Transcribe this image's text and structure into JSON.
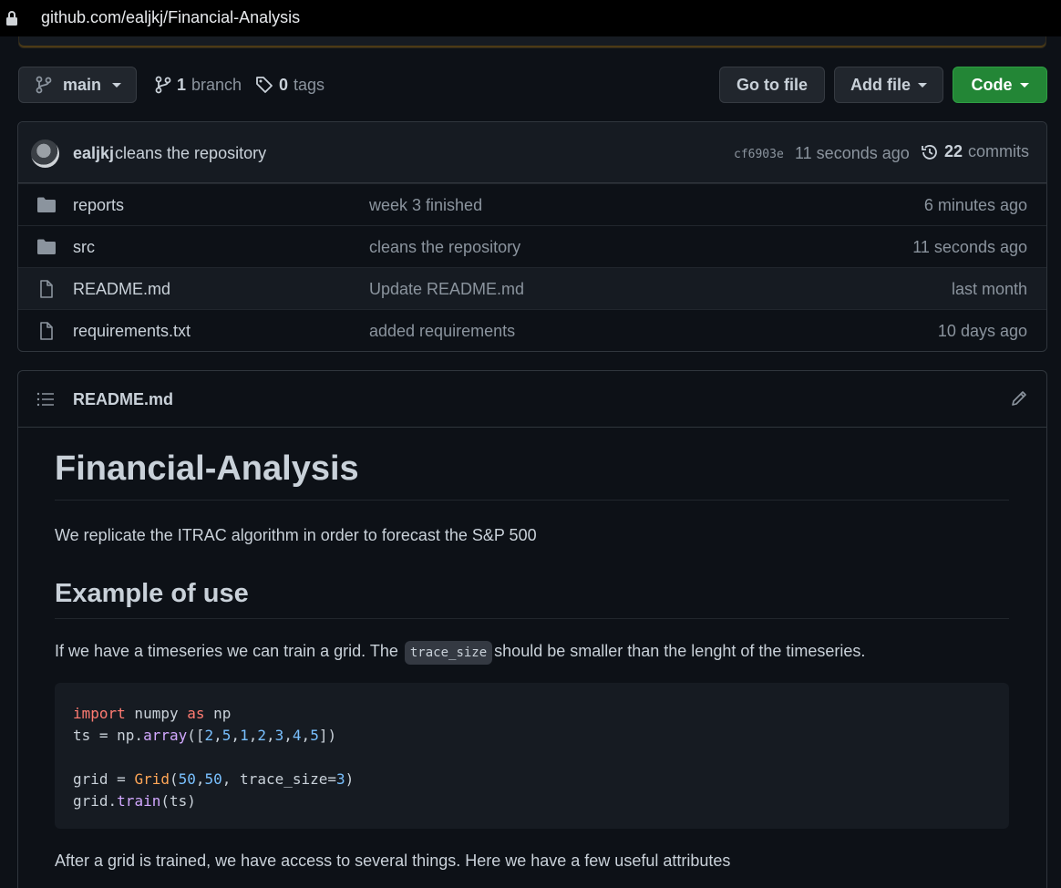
{
  "browser": {
    "url": "github.com/ealjkj/Financial-Analysis"
  },
  "toolbar": {
    "branch": "main",
    "branch_count": "1",
    "branch_word": "branch",
    "tag_count": "0",
    "tag_word": "tags",
    "go_to_file": "Go to file",
    "add_file": "Add file",
    "code": "Code"
  },
  "commit": {
    "author": "ealjkj",
    "message": "cleans the repository",
    "sha": "cf6903e",
    "time": "11 seconds ago",
    "commit_count": "22",
    "commit_word": "commits"
  },
  "files": [
    {
      "type": "folder",
      "name": "reports",
      "message": "week 3 finished",
      "age": "6 minutes ago"
    },
    {
      "type": "folder",
      "name": "src",
      "message": "cleans the repository",
      "age": "11 seconds ago"
    },
    {
      "type": "file",
      "name": "README.md",
      "message": "Update README.md",
      "age": "last month"
    },
    {
      "type": "file",
      "name": "requirements.txt",
      "message": "added requirements",
      "age": "10 days ago"
    }
  ],
  "readme": {
    "filename": "README.md",
    "title": "Financial-Analysis",
    "intro": "We replicate the ITRAC algorithm in order to forecast the S&P 500",
    "section_title": "Example of use",
    "para_before": "If we have a timeseries we can train a grid. The",
    "inline_code": "trace_size",
    "para_after": "should be smaller than the lenght of the timeseries.",
    "code_lines": {
      "l1_kw1": "import",
      "l1_mod": " numpy ",
      "l1_kw2": "as",
      "l1_alias": " np",
      "l2_a": "ts = np.",
      "l2_fn": "array",
      "l2_b": "([",
      "l2_n1": "2",
      "l2_n2": "5",
      "l2_n3": "1",
      "l2_n4": "2",
      "l2_n5": "3",
      "l2_n6": "4",
      "l2_n7": "5",
      "l2_c": "])",
      "l4_a": "grid = ",
      "l4_cls": "Grid",
      "l4_b": "(",
      "l4_n1": "50",
      "l4_n2": "50",
      "l4_c": ", trace_size=",
      "l4_n3": "3",
      "l4_d": ")",
      "l5_a": "grid.",
      "l5_fn": "train",
      "l5_b": "(ts)"
    },
    "after_code": "After a grid is trained, we have access to several things. Here we have a few useful attributes"
  },
  "colors": {
    "code_button": "#238636",
    "background": "#0d1117",
    "border": "#30363d"
  },
  "icons": [
    "lock-icon",
    "git-branch-icon",
    "tag-icon",
    "history-icon",
    "folder-icon",
    "file-icon",
    "list-icon",
    "pencil-icon"
  ]
}
